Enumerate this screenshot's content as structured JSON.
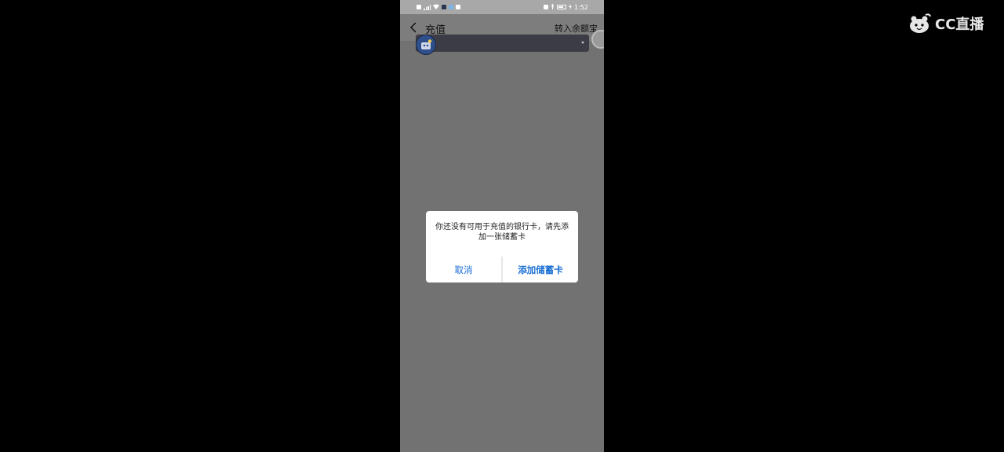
{
  "status_bar": {
    "time": "1:52",
    "battery": "95"
  },
  "navbar": {
    "back_icon": "chevron-left-icon",
    "title": "充值",
    "action": "转入余额宝"
  },
  "dialog": {
    "message": "你还没有可用于充值的银行卡，请先添加一张储蓄卡",
    "cancel_label": "取消",
    "confirm_label": "添加储蓄卡"
  },
  "watermark": {
    "text": "CC直播",
    "icon": "cc-live-logo-icon"
  },
  "colors": {
    "accent": "#1a6fd4",
    "dim_background": "#727272",
    "dialog_background": "#ffffff"
  }
}
